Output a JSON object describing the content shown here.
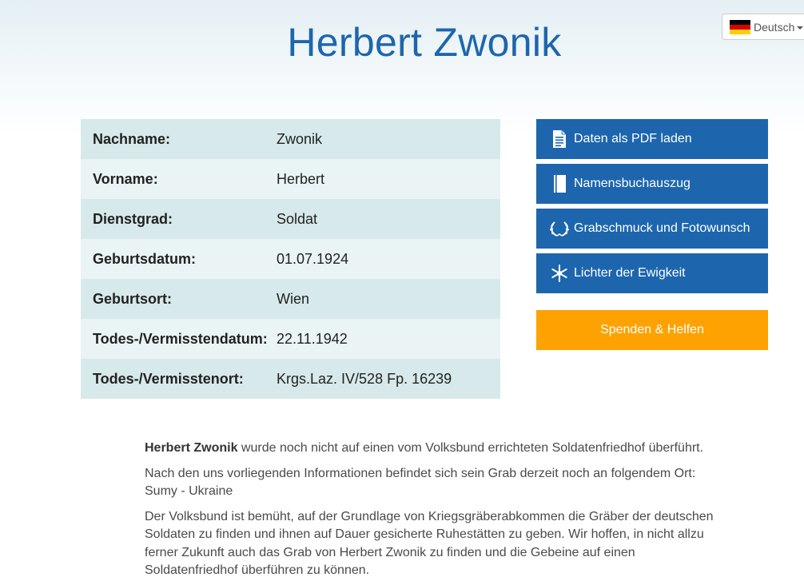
{
  "page": {
    "title": "Herbert Zwonik"
  },
  "language": {
    "label": "Deutsch",
    "flag_icon": "german-flag-icon"
  },
  "details": [
    {
      "key": "Nachname:",
      "value": "Zwonik"
    },
    {
      "key": "Vorname:",
      "value": "Herbert"
    },
    {
      "key": "Dienstgrad:",
      "value": "Soldat"
    },
    {
      "key": "Geburtsdatum:",
      "value": "01.07.1924"
    },
    {
      "key": "Geburtsort:",
      "value": "Wien"
    },
    {
      "key": "Todes-/Vermisstendatum:",
      "value": "22.11.1942"
    },
    {
      "key": "Todes-/Vermisstenort:",
      "value": "Krgs.Laz. IV/528 Fp. 16239"
    }
  ],
  "actions": [
    {
      "label": "Daten als PDF laden",
      "icon": "document-icon"
    },
    {
      "label": "Namensbuchauszug",
      "icon": "book-icon"
    },
    {
      "label": "Grabschmuck und Fotowunsch",
      "icon": "wreath-icon"
    },
    {
      "label": "Lichter der Ewigkeit",
      "icon": "snowflake-icon"
    }
  ],
  "donate": {
    "label": "Spenden & Helfen"
  },
  "body": {
    "p1_name": "Herbert Zwonik",
    "p1_rest": " wurde noch nicht auf einen vom Volksbund errichteten Soldatenfriedhof überführt.",
    "p2_line1": "Nach den uns vorliegenden Informationen befindet sich sein Grab derzeit noch an folgendem Ort:",
    "p2_line2": "Sumy - Ukraine",
    "p3": "Der Volksbund ist bemüht, auf der Grundlage von Kriegsgräberabkommen die Gräber der deutschen Soldaten zu finden und ihnen auf Dauer gesicherte Ruhestätten zu geben. Wir hoffen, in nicht allzu ferner Zukunft auch das Grab von Herbert Zwonik zu finden und die Gebeine auf einen Soldatenfriedhof überführen zu können."
  },
  "colors": {
    "primary": "#1d66ad",
    "accent": "#fda200"
  }
}
